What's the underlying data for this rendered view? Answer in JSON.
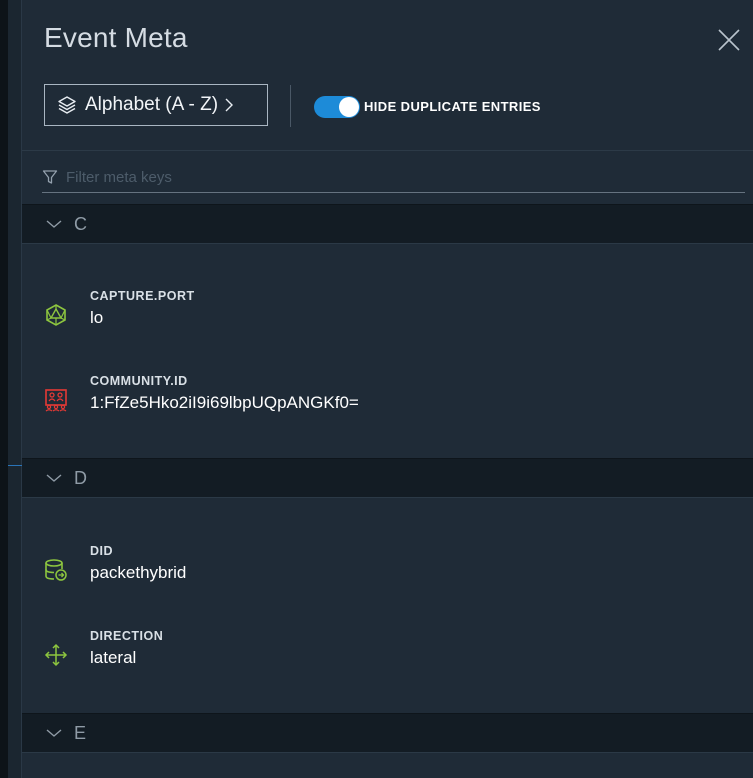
{
  "header": {
    "title": "Event Meta"
  },
  "toolbar": {
    "sort_label": "Alphabet (A - Z)",
    "toggle_label": "HIDE DUPLICATE ENTRIES",
    "toggle_on": true,
    "accent_color": "#1d8bd8"
  },
  "filter": {
    "placeholder": "Filter meta keys"
  },
  "groups": [
    {
      "letter": "C",
      "items": [
        {
          "key": "CAPTURE.PORT",
          "value": "lo",
          "icon": "network-node-icon",
          "icon_color": "#8dc63f"
        },
        {
          "key": "COMMUNITY.ID",
          "value": "1:FfZe5Hko2iI9i69lbpUQpANGKf0=",
          "icon": "community-group-icon",
          "icon_color": "#e53935"
        }
      ]
    },
    {
      "letter": "D",
      "items": [
        {
          "key": "DID",
          "value": "packethybrid",
          "icon": "database-icon",
          "icon_color": "#8dc63f"
        },
        {
          "key": "DIRECTION",
          "value": "lateral",
          "icon": "move-arrows-icon",
          "icon_color": "#8dc63f"
        }
      ]
    },
    {
      "letter": "E",
      "items": []
    }
  ]
}
